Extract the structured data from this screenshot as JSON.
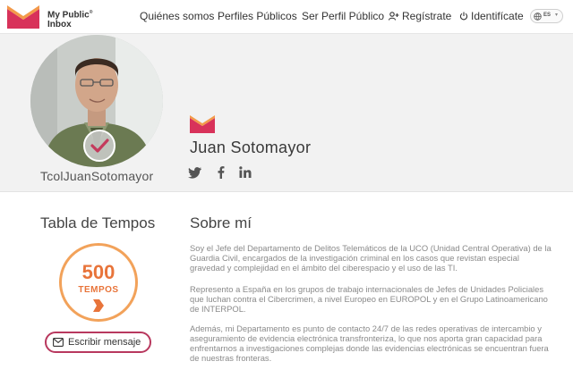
{
  "brand": {
    "line1": "My Public",
    "line2": "Inbox",
    "mark": "®",
    "color": "#d8325a"
  },
  "nav": {
    "quienes": "Quiénes somos",
    "perfiles": "Perfiles Públicos",
    "ser_perfil": "Ser Perfil Público",
    "registrate": "Regístrate",
    "identificate": "Identifícate",
    "lang": "ES"
  },
  "profile": {
    "handle": "TcolJuanSotomayor",
    "name": "Juan Sotomayor",
    "social_icons": [
      "twitter-icon",
      "facebook-icon",
      "linkedin-icon"
    ]
  },
  "score": {
    "title": "Tabla de Tempos",
    "value": "500",
    "unit": "TEMPOS",
    "accent": "#e8743a"
  },
  "actions": {
    "write_message": "Escribir mensaje"
  },
  "about": {
    "title": "Sobre mí",
    "paragraphs": [
      "Soy el Jefe del Departamento de Delitos Telemáticos de la UCO (Unidad Central Operativa) de la Guardia Civil, encargados de la investigación criminal en los casos que revistan especial gravedad y complejidad en el ámbito del ciberespacio y el uso de las TI.",
      "Represento a España en los grupos de trabajo internacionales de Jefes de Unidades Policiales que luchan contra el Cibercrimen, a nivel Europeo en EUROPOL y en el Grupo Latinoamericano de INTERPOL.",
      "Además, mi Departamento es punto de contacto 24/7 de las redes operativas de intercambio y aseguramiento de evidencia electrónica transfronteriza, lo que nos aporta gran capacidad para enfrentarnos a investigaciones complejas donde las evidencias electrónicas se encuentran fuera de nuestras fronteras."
    ]
  }
}
